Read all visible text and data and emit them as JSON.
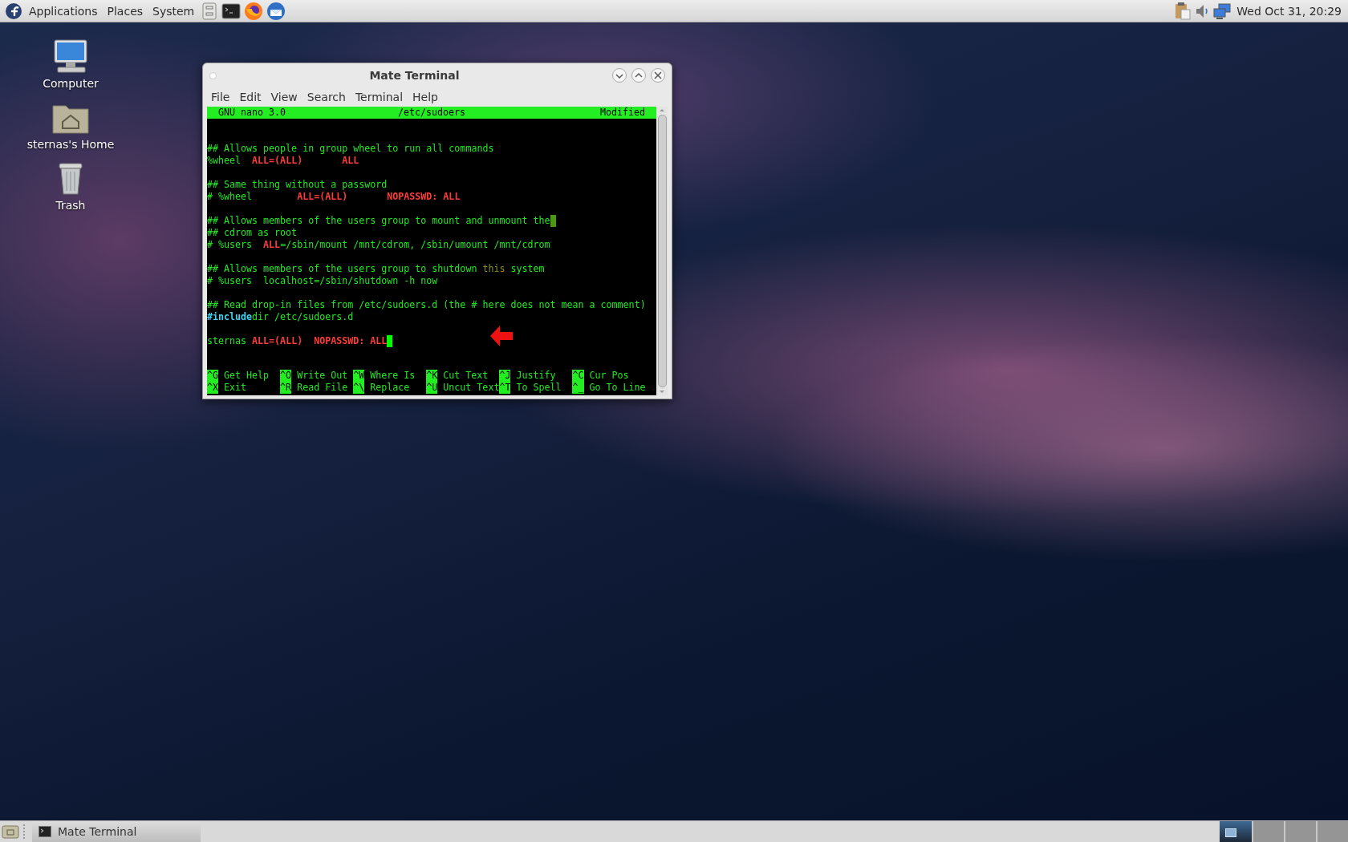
{
  "top_panel": {
    "menus": [
      "Applications",
      "Places",
      "System"
    ],
    "clock": "Wed Oct 31, 20:29"
  },
  "desktop_icons": [
    {
      "label": "Computer",
      "kind": "computer"
    },
    {
      "label": "sternas's Home",
      "kind": "home"
    },
    {
      "label": "Trash",
      "kind": "trash"
    }
  ],
  "window": {
    "title": "Mate Terminal",
    "menu": [
      "File",
      "Edit",
      "View",
      "Search",
      "Terminal",
      "Help"
    ],
    "nano": {
      "header": {
        "version": "GNU nano 3.0",
        "file": "/etc/sudoers",
        "status": "Modified"
      },
      "blocks": [
        {
          "lines": [
            {
              "cursor": false,
              "segments": [
                {
                  "text": "## Allows people in group wheel to run all commands",
                  "kind": "plain"
                }
              ]
            },
            {
              "cursor": false,
              "segments": [
                {
                  "text": "%wheel  ",
                  "kind": "plain"
                },
                {
                  "text": "ALL=(ALL)",
                  "kind": "keyword"
                },
                {
                  "text": "       ALL",
                  "kind": "keyword"
                }
              ]
            }
          ]
        },
        {
          "lines": [
            {
              "cursor": false,
              "segments": [
                {
                  "text": "## Same thing without a password",
                  "kind": "plain"
                }
              ]
            },
            {
              "cursor": false,
              "segments": [
                {
                  "text": "# %wheel        ",
                  "kind": "plain"
                },
                {
                  "text": "ALL=(ALL)",
                  "kind": "keyword"
                },
                {
                  "text": "       NOPASSWD: ALL",
                  "kind": "keyword"
                }
              ]
            }
          ]
        },
        {
          "lines": [
            {
              "cursor": true,
              "segments": [
                {
                  "text": "## Allows members of the users group to mount and unmount the",
                  "kind": "plain"
                }
              ]
            },
            {
              "cursor": false,
              "segments": [
                {
                  "text": "## cdrom as root",
                  "kind": "plain"
                }
              ]
            },
            {
              "cursor": false,
              "segments": [
                {
                  "text": "# %users  ",
                  "kind": "plain"
                },
                {
                  "text": "ALL",
                  "kind": "keyword"
                },
                {
                  "text": "=/sbin/mount /mnt/cdrom, /sbin/umount /mnt/cdrom",
                  "kind": "plain"
                }
              ]
            }
          ]
        },
        {
          "lines": [
            {
              "cursor": false,
              "segments": [
                {
                  "text": "## Allows members of the users group to shutdown ",
                  "kind": "plain"
                },
                {
                  "text": "this",
                  "kind": "dim"
                },
                {
                  "text": " system",
                  "kind": "plain"
                }
              ]
            },
            {
              "cursor": false,
              "segments": [
                {
                  "text": "# %users  localhost=/sbin/shutdown -h now",
                  "kind": "plain"
                }
              ]
            }
          ]
        },
        {
          "lines": [
            {
              "cursor": false,
              "segments": [
                {
                  "text": "## Read drop-in files from /etc/sudoers.d (the # here does not mean a comment)",
                  "kind": "plain"
                }
              ]
            },
            {
              "cursor": false,
              "segments": [
                {
                  "text": "#include",
                  "kind": "directive"
                },
                {
                  "text": "dir /etc/sudoers.d",
                  "kind": "plain"
                }
              ]
            }
          ]
        },
        {
          "lines": [
            {
              "cursor": true,
              "segments": [
                {
                  "text": "sternas ",
                  "kind": "plain"
                },
                {
                  "text": "ALL=(ALL)",
                  "kind": "keyword"
                },
                {
                  "text": "  NOPASSWD: ALL",
                  "kind": "keyword"
                }
              ]
            }
          ]
        }
      ],
      "shortcuts": [
        {
          "key": "^G",
          "label": "Get Help"
        },
        {
          "key": "^O",
          "label": "Write Out"
        },
        {
          "key": "^W",
          "label": "Where Is"
        },
        {
          "key": "^K",
          "label": "Cut Text"
        },
        {
          "key": "^J",
          "label": "Justify"
        },
        {
          "key": "^C",
          "label": "Cur Pos"
        },
        {
          "key": "^X",
          "label": "Exit"
        },
        {
          "key": "^R",
          "label": "Read File"
        },
        {
          "key": "^\\",
          "label": "Replace"
        },
        {
          "key": "^U",
          "label": "Uncut Text"
        },
        {
          "key": "^T",
          "label": "To Spell"
        },
        {
          "key": "^_",
          "label": "Go To Line"
        }
      ]
    }
  },
  "taskbar": {
    "tasks": [
      {
        "label": "Mate Terminal"
      }
    ]
  },
  "workspaces": [
    {
      "selected": true
    },
    {
      "selected": false
    },
    {
      "selected": false
    },
    {
      "selected": false
    }
  ]
}
